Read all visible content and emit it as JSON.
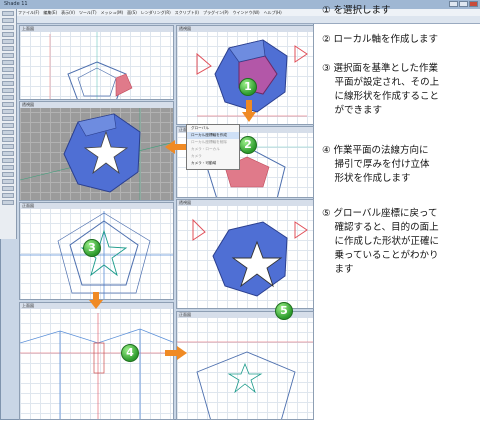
{
  "app": {
    "window_title": "Shade 11",
    "menu": [
      "ファイル(F)",
      "編集(E)",
      "表示(V)",
      "ツール(T)",
      "メッシュ(M)",
      "面(S)",
      "レンダリング(R)",
      "スクリプト(I)",
      "プラグイン(P)",
      "ウインドウ(W)",
      "ヘルプ(H)"
    ]
  },
  "views": {
    "top_left": "上面図",
    "top_right": "透視図",
    "front_left": "透視図",
    "side_left": "正面図",
    "bottom_left": "上面図",
    "right_mid": "正面図",
    "right_lower": "透視図",
    "right_bottom": "正面図"
  },
  "context_menu": {
    "items": [
      "グローバル",
      "ローカル座標軸を作成",
      "ローカル座標軸を削除",
      "カメラ・ローカル",
      "カメラ",
      "カメラ・可動域"
    ]
  },
  "badges": {
    "b1": "1",
    "b2": "2",
    "b3": "3",
    "b4": "4",
    "b5": "5"
  },
  "instructions": {
    "s1": "① を選択します",
    "s2": "② ローカル軸を作成します",
    "s3": "③ 選択面を基準とした作業\n　 平面が設定され、その上\n　 に線形状を作成すること\n　 ができます",
    "s4": "④ 作業平面の法線方向に\n　 掃引で厚みを付け立体\n　 形状を作成します",
    "s5": "⑤ グローバル座標に戻って\n　 確認すると、目的の面上\n　 に作成した形状が正確に\n　 乗っていることがわかり\n　 ます"
  },
  "colors": {
    "arrow_orange": "#f08a24",
    "badge_green": "#2c9a2c",
    "shape_blue": "#5a78d6",
    "face_pink": "#e07a8a"
  }
}
